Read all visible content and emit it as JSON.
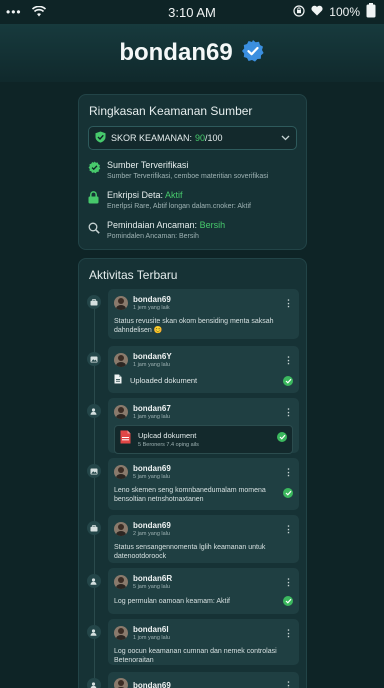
{
  "status_bar": {
    "dots": "•••",
    "time": "3:10 AM",
    "battery": "100%"
  },
  "header": {
    "title": "bondan69"
  },
  "security": {
    "title": "Ringkasan Keamanan Sumber",
    "score_label": "SKOR KEAMANAN:",
    "score_value": "90",
    "score_total": "/100",
    "items": [
      {
        "title": "Sumber Terverifikasi",
        "value": "",
        "subtitle": "Sumber Terverifikasi, cemboe materitian soverifikasi",
        "icon": "verified-badge-icon"
      },
      {
        "title": "Enkripsi Deta:",
        "value": "Aktif",
        "subtitle": "Enerlpsi Rare, Abtif longan dalam.cnoker: Aktif",
        "icon": "lock-icon"
      },
      {
        "title": "Pemindaian Ancaman:",
        "value": "Bersih",
        "subtitle": "Pomindalen Ancaman: Bersih",
        "icon": "search-icon"
      }
    ]
  },
  "activity": {
    "title": "Aktivitas Terbaru",
    "items": [
      {
        "user": "bondan69",
        "time": "1 jem yang laik",
        "text": "Status revusite skan okom bensiding menta saksah dahndelisen 😊",
        "icon": "briefcase-icon"
      },
      {
        "user": "bondan6Y",
        "time": "1 jam yang lalu",
        "doc": "Uploaded dokument",
        "icon": "image-icon"
      },
      {
        "user": "bondan67",
        "time": "1 jam yang lalu",
        "file_name": "Uplcad dokument",
        "file_meta": "5 Beroners 7.4 oping ails",
        "icon": "user-icon"
      },
      {
        "user": "bondan69",
        "time": "5 jam yang lalu",
        "text": "Leno skemen seng komnbanedumalam momena bensoltian netnshotnaxtanen",
        "icon": "image-icon"
      },
      {
        "user": "bondan69",
        "time": "2 jam yang lalu",
        "text": "Status sensangennomenta lglih keamanan untuk datenootdoroock",
        "icon": "briefcase-icon"
      },
      {
        "user": "bondan6R",
        "time": "5 jam yang lalu",
        "text": "Log permulan oamoan keamam: Aktif",
        "icon": "user-icon"
      },
      {
        "user": "bondan6I",
        "time": "1 jom yang lalu",
        "text": "Log oocun keamanan cumnan dan nemek controlasi Betenoraitan",
        "icon": "user-icon"
      },
      {
        "user": "bondan69",
        "time": "",
        "text": "",
        "icon": "user-icon"
      }
    ]
  },
  "colors": {
    "background": "#0e2426",
    "card": "#163235",
    "accent_green": "#47c96c",
    "verified_blue": "#3b8fe0"
  }
}
